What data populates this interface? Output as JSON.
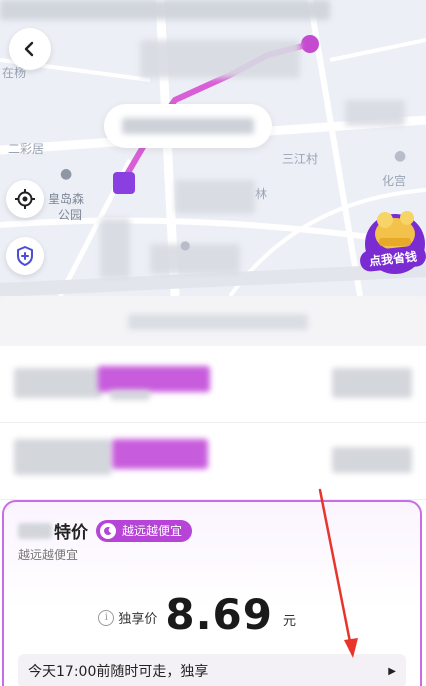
{
  "map": {
    "labels": [
      "在杨",
      "二彩居",
      "皇岛森",
      "公园",
      "林",
      "化宫",
      "三江村"
    ],
    "promo_text": "点我省钱"
  },
  "card": {
    "title": "特价",
    "tag_label": "越远越便宜",
    "subtitle": "越远越便宜",
    "price_label": "独享价",
    "price_value": "8.69",
    "price_unit": "元",
    "notice_text": "今天17:00前随时可走，独享",
    "notice_arrow": "▶",
    "info_glyph": "i"
  },
  "colors": {
    "route": "#d85fd8",
    "accent": "#b644d6",
    "annotation": "#e8342a"
  }
}
